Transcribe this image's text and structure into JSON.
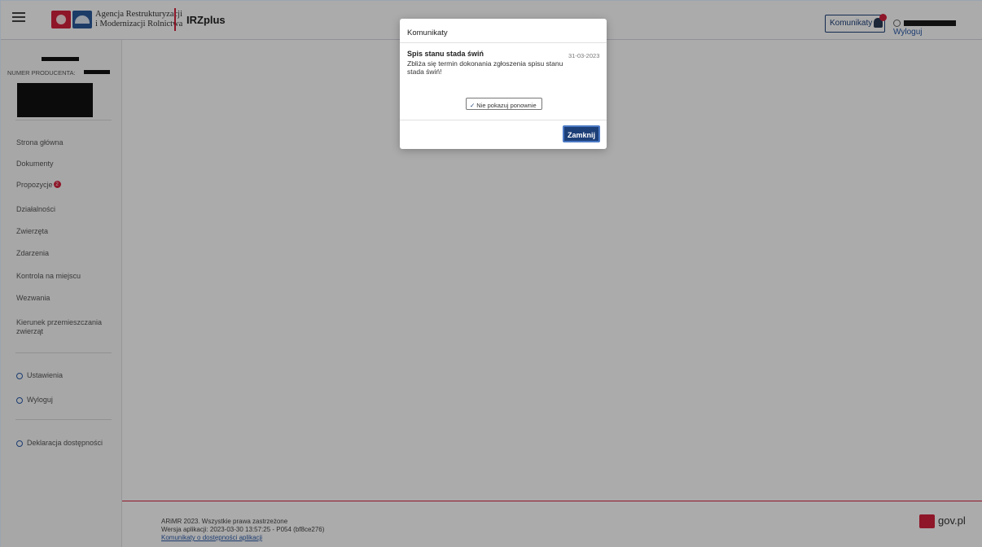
{
  "header": {
    "agency_line1": "Agencja Restrukturyzacji",
    "agency_line2": "i Modernizacji Rolnictwa",
    "app_name": "IRZplus",
    "messages_button": "Komunikaty",
    "logout_link": "Wyloguj"
  },
  "sidebar": {
    "producer_label": "NUMER PRODUCENTA: ",
    "nav_items": [
      {
        "label": "Strona główna"
      },
      {
        "label": "Dokumenty"
      },
      {
        "label": "Propozycje",
        "badge": "2"
      },
      {
        "label": "Działalności"
      },
      {
        "label": "Zwierzęta"
      },
      {
        "label": "Zdarzenia"
      },
      {
        "label": "Kontrola na miejscu"
      },
      {
        "label": "Wezwania"
      },
      {
        "label": "Kierunek przemieszczania zwierząt"
      }
    ],
    "settings": "Ustawienia",
    "logout": "Wyloguj",
    "accessibility": "Deklaracja dostępności"
  },
  "modal": {
    "title": "Komunikaty",
    "subject": "Spis stanu stada świń",
    "date": "31-03-2023",
    "body": "Zbliża się termin dokonania zgłoszenia spisu stanu stada świń!",
    "dismiss_label": "Nie pokazuj ponownie",
    "close_label": "Zamknij"
  },
  "footer": {
    "copyright": "ARiMR 2023. Wszystkie prawa zastrzeżone",
    "version": "Wersja aplikacji: 2023-03-30 13:57:25 - P054 (bf8ce276)",
    "accessibility_link": "Komunikaty o dostępności aplikacji",
    "gov": "gov.pl"
  },
  "colors": {
    "accent_blue": "#1d3f78",
    "accent_red": "#d4213d",
    "link_blue": "#2b5aa8"
  }
}
